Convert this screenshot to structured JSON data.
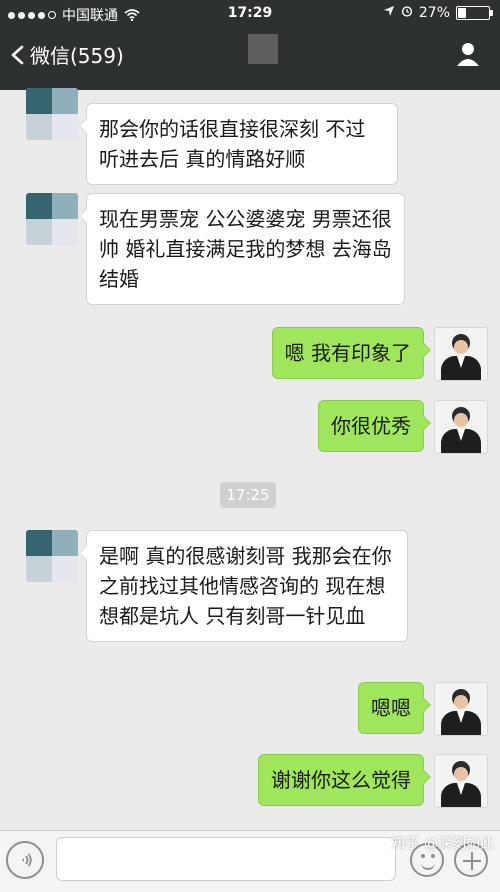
{
  "status": {
    "carrier": "中国联通",
    "time": "17:29",
    "battery_percent": "27%",
    "battery_level": 0.27
  },
  "nav": {
    "back_label": "微信(559)"
  },
  "timestamp": "17:25",
  "messages": [
    {
      "side": "left",
      "text": "那会你的话很直接很深刻 不过听进去后 真的情路好顺"
    },
    {
      "side": "left",
      "text": "现在男票宠 公公婆婆宠 男票还很帅 婚礼直接满足我的梦想 去海岛结婚"
    },
    {
      "side": "right",
      "text": "嗯 我有印象了"
    },
    {
      "side": "right",
      "text": "你很优秀"
    },
    {
      "side": "left",
      "text": "是啊 真的很感谢刻哥 我那会在你之前找过其他情感咨询的 现在想想都是坑人 只有刻哥一针见血"
    },
    {
      "side": "right",
      "text": "嗯嗯"
    },
    {
      "side": "right",
      "text": "谢谢你这么觉得"
    }
  ],
  "watermark": "知乎 @深刻如此",
  "colors": {
    "header_bg": "#2e3132",
    "chat_bg": "#ebebeb",
    "right_bubble": "#9fe65c",
    "left_bubble": "#ffffff"
  },
  "icons": {
    "back": "chevron-left-icon",
    "profile": "user-icon",
    "voice": "voice-icon",
    "emoji": "emoji-icon",
    "plus": "plus-icon"
  }
}
